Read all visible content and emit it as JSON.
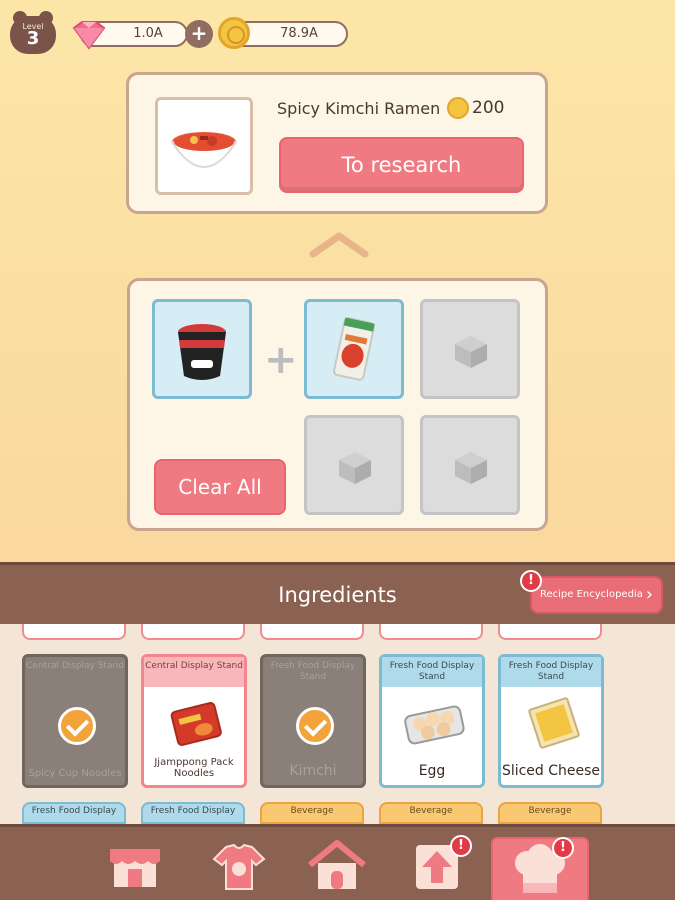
{
  "hud": {
    "level_label": "Level",
    "level_value": "3",
    "gems_value": "1.0A",
    "coins_value": "78.9A",
    "icons": [
      "bear-icon",
      "gem-icon",
      "plus-icon",
      "coin-icon"
    ]
  },
  "recipe": {
    "name": "Spicy Kimchi Ramen",
    "cost": "200",
    "research_label": "To research",
    "image": "ramen-bowl-icon"
  },
  "combine": {
    "slots": [
      {
        "state": "filled",
        "icon": "cup-noodle-icon"
      },
      {
        "state": "filled",
        "icon": "kimchi-pack-icon"
      },
      {
        "state": "empty"
      },
      {
        "state": "empty"
      },
      {
        "state": "empty"
      }
    ],
    "clear_label": "Clear All"
  },
  "ingredients": {
    "title": "Ingredients",
    "encyclopedia_label": "Recipe Encyclopedia",
    "cards": [
      {
        "tag": "Central Display Stand",
        "name": "Spicy Cup Noodles",
        "style": "used"
      },
      {
        "tag": "Central Display Stand",
        "name": "Jjamppong Pack Noodles",
        "style": "pink"
      },
      {
        "tag": "Fresh Food Display Stand",
        "name": "Kimchi",
        "style": "used"
      },
      {
        "tag": "Fresh Food Display Stand",
        "name": "Egg",
        "style": "blue"
      },
      {
        "tag": "Fresh Food Display Stand",
        "name": "Sliced Cheese",
        "style": "blue"
      }
    ],
    "next_row_tags": [
      "Fresh Food Display",
      "Fresh Food Display",
      "Beverage",
      "Beverage",
      "Beverage"
    ]
  },
  "nav": {
    "items": [
      {
        "icon": "shop-icon"
      },
      {
        "icon": "shirt-icon"
      },
      {
        "icon": "home-icon"
      },
      {
        "icon": "upgrade-arrow-icon"
      },
      {
        "icon": "chef-hat-icon"
      }
    ]
  },
  "colors": {
    "accent_pink": "#f07a82",
    "brown": "#8b6152",
    "blue_border": "#7dbbd3"
  }
}
